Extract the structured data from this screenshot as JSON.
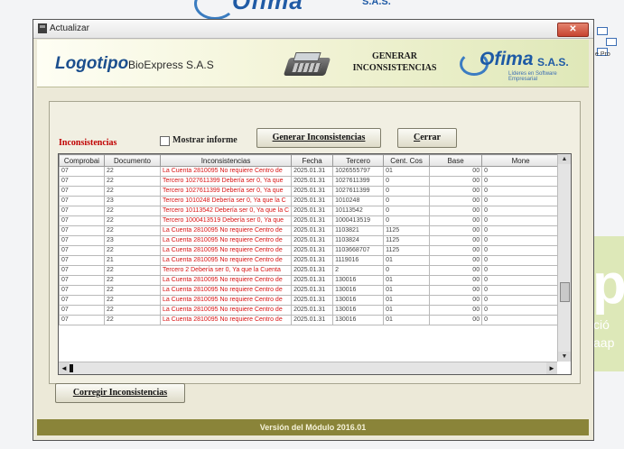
{
  "background": {
    "top_logo_word": "Ofima",
    "top_logo_sub": "S.A.S.",
    "right_letter": "p",
    "right_text_1": "ció",
    "right_text_2": "aap",
    "right_icon_label": "e Pro"
  },
  "window": {
    "title": "Actualizar",
    "close_label": "✕"
  },
  "header": {
    "logo_text": "Logotipo",
    "company": "BioExpress S.A.S",
    "module_title_line1": "GENERAR",
    "module_title_line2": "INCONSISTENCIAS",
    "brand": "Ofima",
    "brand_suffix": "S.A.S.",
    "brand_tagline": "Líderes en Software Empresarial"
  },
  "controls": {
    "section_label": "Inconsistencias",
    "show_report_label": "Mostrar informe",
    "show_report_checked": false,
    "generate_button": "Generar Inconsistencias",
    "close_button_first": "C",
    "close_button_rest": "errar",
    "fix_button": "Corregir Inconsistencias"
  },
  "grid": {
    "columns": [
      "Comprobai",
      "Documento",
      "Inconsistencias",
      "Fecha",
      "Tercero",
      "Cent. Cos",
      "Base",
      "Mone"
    ],
    "rows": [
      [
        "07",
        "22",
        "La Cuenta  2810095 No requiere Centro de",
        "2025.01.31",
        "1026555797",
        "01",
        "00",
        "0"
      ],
      [
        "07",
        "22",
        "Tercero  1027611399 Debería ser 0, Ya que",
        "2025.01.31",
        "1027611399",
        "0",
        "00",
        "0"
      ],
      [
        "07",
        "22",
        "Tercero  1027611399 Debería ser 0, Ya que",
        "2025.01.31",
        "1027611399",
        "0",
        "00",
        "0"
      ],
      [
        "07",
        "23",
        "Tercero  1010248 Debería ser 0, Ya que la C",
        "2025.01.31",
        "1010248",
        "0",
        "00",
        "0"
      ],
      [
        "07",
        "22",
        "Tercero  10113542 Debería ser 0, Ya que la C",
        "2025.01.31",
        "10113542",
        "0",
        "00",
        "0"
      ],
      [
        "07",
        "22",
        "Tercero  1000413519 Debería ser 0, Ya que",
        "2025.01.31",
        "1000413519",
        "0",
        "00",
        "0"
      ],
      [
        "07",
        "22",
        "La Cuenta  2810095 No requiere Centro de",
        "2025.01.31",
        "1103821",
        "1125",
        "00",
        "0"
      ],
      [
        "07",
        "23",
        "La Cuenta  2810095 No requiere Centro de",
        "2025.01.31",
        "1103824",
        "1125",
        "00",
        "0"
      ],
      [
        "07",
        "22",
        "La Cuenta  2810095 No requiere Centro de",
        "2025.01.31",
        "1103668707",
        "1125",
        "00",
        "0"
      ],
      [
        "07",
        "21",
        "La Cuenta  2810095 No requiere Centro de",
        "2025.01.31",
        "1119016",
        "01",
        "00",
        "0"
      ],
      [
        "07",
        "22",
        "Tercero  2 Debería ser 0, Ya que la Cuenta",
        "2025.01.31",
        "2",
        "0",
        "00",
        "0"
      ],
      [
        "07",
        "22",
        "La Cuenta  2810095 No requiere Centro de",
        "2025.01.31",
        "130016",
        "01",
        "00",
        "0"
      ],
      [
        "07",
        "22",
        "La Cuenta  2810095 No requiere Centro de",
        "2025.01.31",
        "130016",
        "01",
        "00",
        "0"
      ],
      [
        "07",
        "22",
        "La Cuenta  2810095 No requiere Centro de",
        "2025.01.31",
        "130016",
        "01",
        "00",
        "0"
      ],
      [
        "07",
        "22",
        "La Cuenta  2810095 No requiere Centro de",
        "2025.01.31",
        "130016",
        "01",
        "00",
        "0"
      ],
      [
        "07",
        "22",
        "La Cuenta  2810095 No requiere Centro de",
        "2025.01.31",
        "130016",
        "01",
        "00",
        "0"
      ]
    ]
  },
  "footer": {
    "version": "Versión del Módulo 2016.01"
  },
  "colors": {
    "inconsistency_text": "#d81414",
    "footer_bar": "#8a8439",
    "brand_blue": "#1d5aa5"
  }
}
